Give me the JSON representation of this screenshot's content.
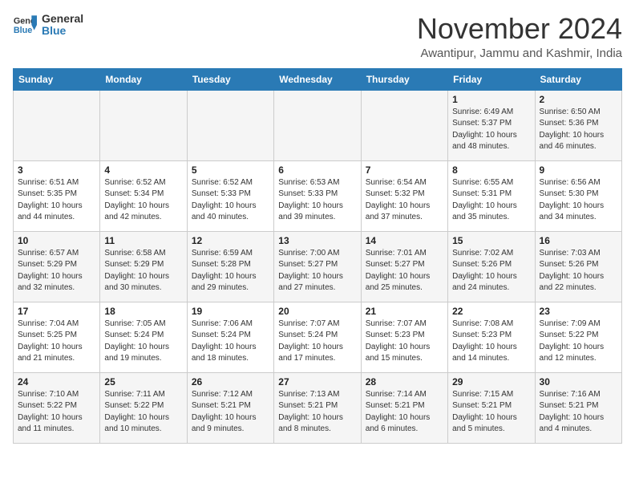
{
  "header": {
    "logo_general": "General",
    "logo_blue": "Blue",
    "month_title": "November 2024",
    "location": "Awantipur, Jammu and Kashmir, India"
  },
  "weekdays": [
    "Sunday",
    "Monday",
    "Tuesday",
    "Wednesday",
    "Thursday",
    "Friday",
    "Saturday"
  ],
  "weeks": [
    [
      {
        "day": "",
        "info": ""
      },
      {
        "day": "",
        "info": ""
      },
      {
        "day": "",
        "info": ""
      },
      {
        "day": "",
        "info": ""
      },
      {
        "day": "",
        "info": ""
      },
      {
        "day": "1",
        "info": "Sunrise: 6:49 AM\nSunset: 5:37 PM\nDaylight: 10 hours\nand 48 minutes."
      },
      {
        "day": "2",
        "info": "Sunrise: 6:50 AM\nSunset: 5:36 PM\nDaylight: 10 hours\nand 46 minutes."
      }
    ],
    [
      {
        "day": "3",
        "info": "Sunrise: 6:51 AM\nSunset: 5:35 PM\nDaylight: 10 hours\nand 44 minutes."
      },
      {
        "day": "4",
        "info": "Sunrise: 6:52 AM\nSunset: 5:34 PM\nDaylight: 10 hours\nand 42 minutes."
      },
      {
        "day": "5",
        "info": "Sunrise: 6:52 AM\nSunset: 5:33 PM\nDaylight: 10 hours\nand 40 minutes."
      },
      {
        "day": "6",
        "info": "Sunrise: 6:53 AM\nSunset: 5:33 PM\nDaylight: 10 hours\nand 39 minutes."
      },
      {
        "day": "7",
        "info": "Sunrise: 6:54 AM\nSunset: 5:32 PM\nDaylight: 10 hours\nand 37 minutes."
      },
      {
        "day": "8",
        "info": "Sunrise: 6:55 AM\nSunset: 5:31 PM\nDaylight: 10 hours\nand 35 minutes."
      },
      {
        "day": "9",
        "info": "Sunrise: 6:56 AM\nSunset: 5:30 PM\nDaylight: 10 hours\nand 34 minutes."
      }
    ],
    [
      {
        "day": "10",
        "info": "Sunrise: 6:57 AM\nSunset: 5:29 PM\nDaylight: 10 hours\nand 32 minutes."
      },
      {
        "day": "11",
        "info": "Sunrise: 6:58 AM\nSunset: 5:29 PM\nDaylight: 10 hours\nand 30 minutes."
      },
      {
        "day": "12",
        "info": "Sunrise: 6:59 AM\nSunset: 5:28 PM\nDaylight: 10 hours\nand 29 minutes."
      },
      {
        "day": "13",
        "info": "Sunrise: 7:00 AM\nSunset: 5:27 PM\nDaylight: 10 hours\nand 27 minutes."
      },
      {
        "day": "14",
        "info": "Sunrise: 7:01 AM\nSunset: 5:27 PM\nDaylight: 10 hours\nand 25 minutes."
      },
      {
        "day": "15",
        "info": "Sunrise: 7:02 AM\nSunset: 5:26 PM\nDaylight: 10 hours\nand 24 minutes."
      },
      {
        "day": "16",
        "info": "Sunrise: 7:03 AM\nSunset: 5:26 PM\nDaylight: 10 hours\nand 22 minutes."
      }
    ],
    [
      {
        "day": "17",
        "info": "Sunrise: 7:04 AM\nSunset: 5:25 PM\nDaylight: 10 hours\nand 21 minutes."
      },
      {
        "day": "18",
        "info": "Sunrise: 7:05 AM\nSunset: 5:24 PM\nDaylight: 10 hours\nand 19 minutes."
      },
      {
        "day": "19",
        "info": "Sunrise: 7:06 AM\nSunset: 5:24 PM\nDaylight: 10 hours\nand 18 minutes."
      },
      {
        "day": "20",
        "info": "Sunrise: 7:07 AM\nSunset: 5:24 PM\nDaylight: 10 hours\nand 17 minutes."
      },
      {
        "day": "21",
        "info": "Sunrise: 7:07 AM\nSunset: 5:23 PM\nDaylight: 10 hours\nand 15 minutes."
      },
      {
        "day": "22",
        "info": "Sunrise: 7:08 AM\nSunset: 5:23 PM\nDaylight: 10 hours\nand 14 minutes."
      },
      {
        "day": "23",
        "info": "Sunrise: 7:09 AM\nSunset: 5:22 PM\nDaylight: 10 hours\nand 12 minutes."
      }
    ],
    [
      {
        "day": "24",
        "info": "Sunrise: 7:10 AM\nSunset: 5:22 PM\nDaylight: 10 hours\nand 11 minutes."
      },
      {
        "day": "25",
        "info": "Sunrise: 7:11 AM\nSunset: 5:22 PM\nDaylight: 10 hours\nand 10 minutes."
      },
      {
        "day": "26",
        "info": "Sunrise: 7:12 AM\nSunset: 5:21 PM\nDaylight: 10 hours\nand 9 minutes."
      },
      {
        "day": "27",
        "info": "Sunrise: 7:13 AM\nSunset: 5:21 PM\nDaylight: 10 hours\nand 8 minutes."
      },
      {
        "day": "28",
        "info": "Sunrise: 7:14 AM\nSunset: 5:21 PM\nDaylight: 10 hours\nand 6 minutes."
      },
      {
        "day": "29",
        "info": "Sunrise: 7:15 AM\nSunset: 5:21 PM\nDaylight: 10 hours\nand 5 minutes."
      },
      {
        "day": "30",
        "info": "Sunrise: 7:16 AM\nSunset: 5:21 PM\nDaylight: 10 hours\nand 4 minutes."
      }
    ]
  ]
}
